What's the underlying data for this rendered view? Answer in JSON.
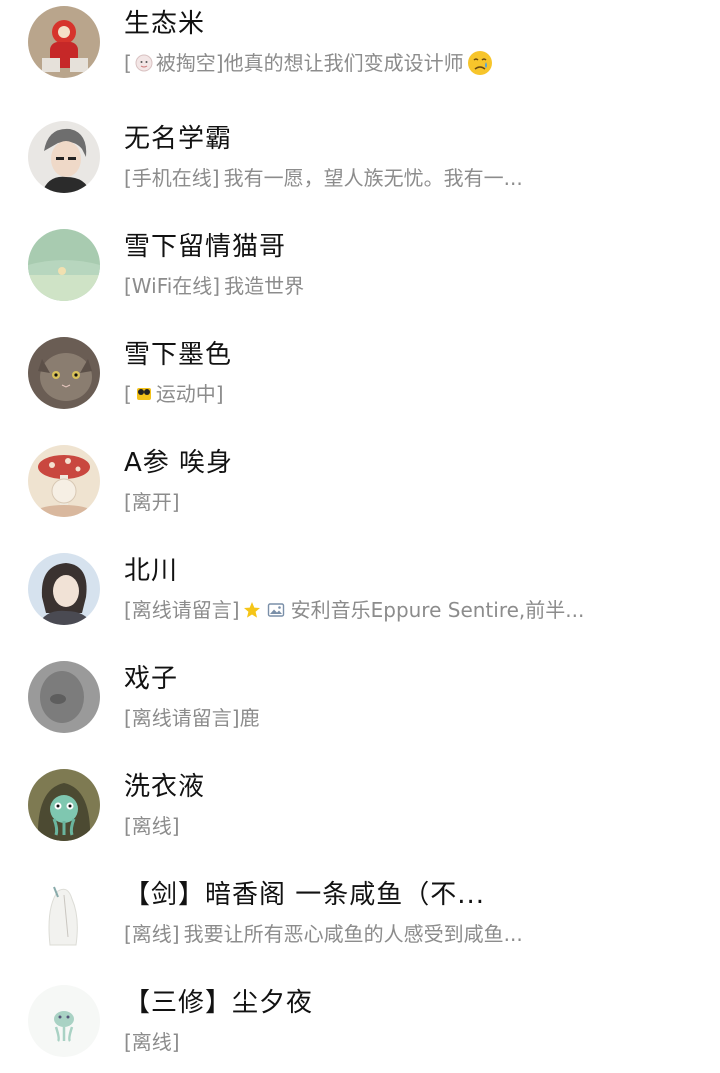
{
  "contacts": [
    {
      "name": "生态米",
      "status_tag": "[",
      "status_tag_after": "被掏空]",
      "message": "他真的想让我们变成设计师",
      "leading_icon": "emoji-face-icon",
      "trailing_icon": "crying-emoji-icon"
    },
    {
      "name": "无名学霸",
      "status_tag": "[手机在线]",
      "message": "我有一愿，望人族无忧。我有一..."
    },
    {
      "name": "雪下留情猫哥",
      "status_tag": "[WiFi在线]",
      "message": "我造世界"
    },
    {
      "name": "雪下墨色",
      "status_tag": "[",
      "status_tag_after": "运动中]",
      "message": "",
      "leading_icon": "running-shoe-icon"
    },
    {
      "name": "A参 唉身",
      "status_tag": "[离开]",
      "message": ""
    },
    {
      "name": "北川",
      "status_tag": "[离线请留言]",
      "message": "安利音乐Eppure Sentire,前半...",
      "icons": [
        "star-icon",
        "image-icon"
      ]
    },
    {
      "name": "戏子",
      "status_tag": "[离线请留言]",
      "message": "鹿"
    },
    {
      "name": "洗衣液",
      "status_tag": "[离线]",
      "message": ""
    },
    {
      "name": "【剑】暗香阁 一条咸鱼（不...",
      "status_tag": "[离线]",
      "message": "我要让所有恶心咸鱼的人感受到咸鱼..."
    },
    {
      "name": "【三修】尘夕夜",
      "status_tag": "[离线]",
      "message": ""
    }
  ],
  "colors": {
    "name": "#121212",
    "status": "#8c8c8c",
    "background": "#ffffff",
    "star": "#f5c518"
  }
}
